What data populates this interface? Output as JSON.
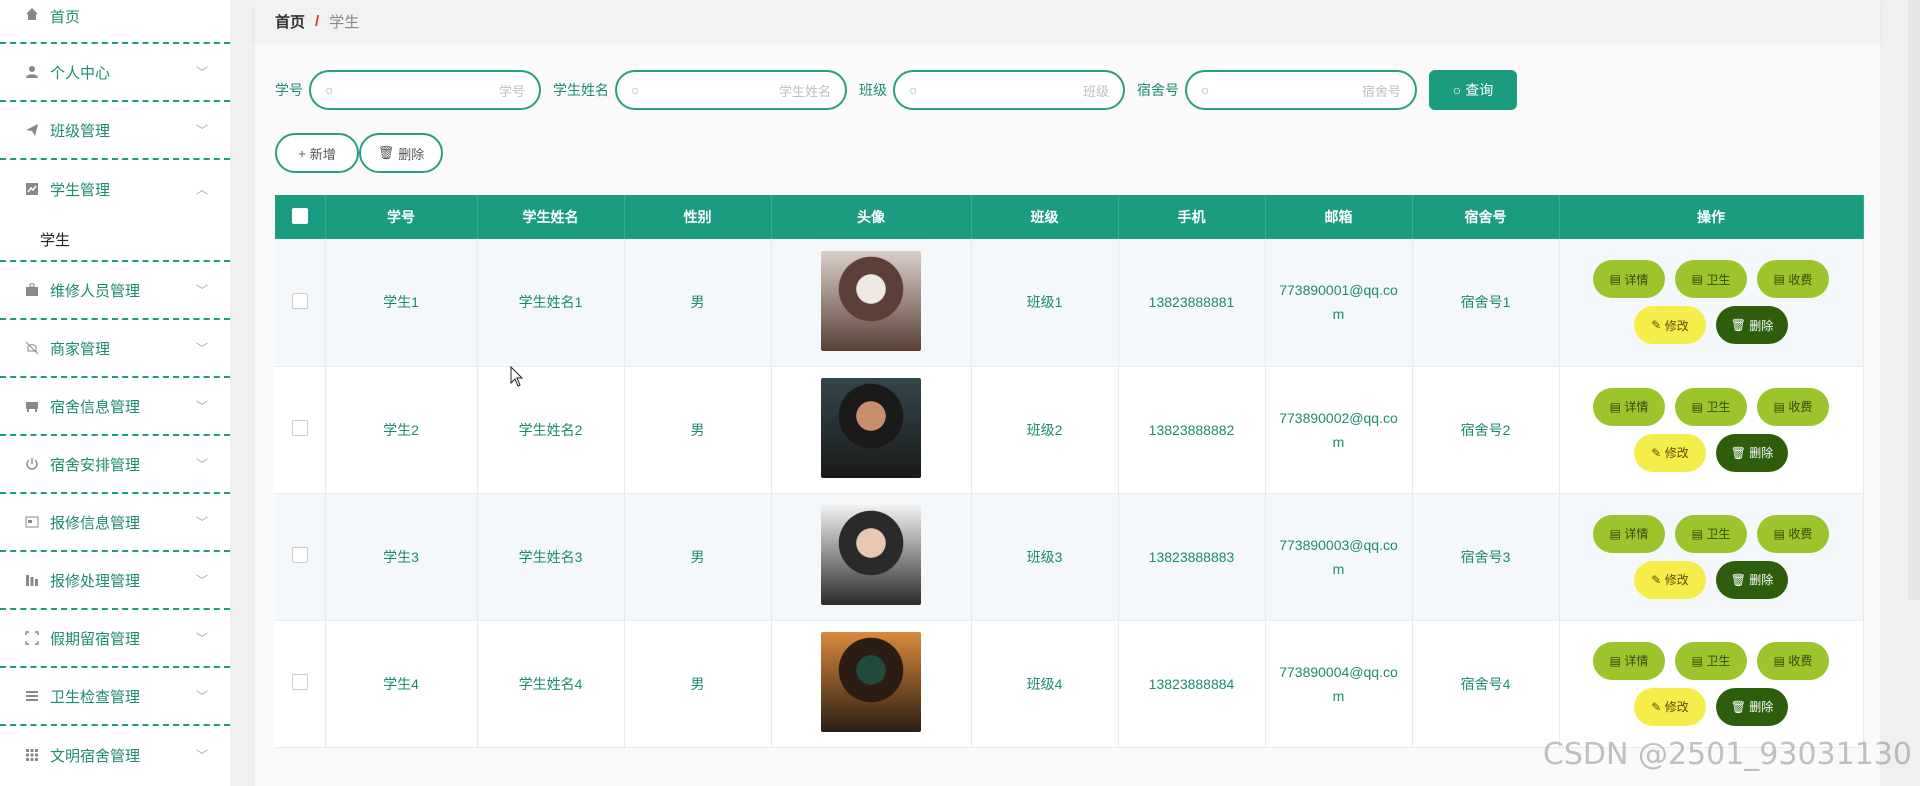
{
  "sidebar": {
    "items": [
      {
        "label": "首页",
        "icon": "home-icon"
      },
      {
        "label": "个人中心",
        "icon": "user-icon"
      },
      {
        "label": "班级管理",
        "icon": "send-icon"
      },
      {
        "label": "学生管理",
        "icon": "chart-icon",
        "expanded": true,
        "sub": "学生"
      },
      {
        "label": "维修人员管理",
        "icon": "briefcase-icon"
      },
      {
        "label": "商家管理",
        "icon": "bell-off-icon"
      },
      {
        "label": "宿舍信息管理",
        "icon": "bed-icon"
      },
      {
        "label": "宿舍安排管理",
        "icon": "power-icon"
      },
      {
        "label": "报修信息管理",
        "icon": "id-card-icon"
      },
      {
        "label": "报修处理管理",
        "icon": "bars-icon"
      },
      {
        "label": "假期留宿管理",
        "icon": "frame-icon"
      },
      {
        "label": "卫生检查管理",
        "icon": "list-icon"
      },
      {
        "label": "文明宿舍管理",
        "icon": "grid-icon"
      }
    ]
  },
  "breadcrumb": {
    "home": "首页",
    "sep": "/",
    "current": "学生"
  },
  "search": {
    "fields": [
      {
        "label": "学号",
        "placeholder": "学号"
      },
      {
        "label": "学生姓名",
        "placeholder": "学生姓名"
      },
      {
        "label": "班级",
        "placeholder": "班级"
      },
      {
        "label": "宿舍号",
        "placeholder": "宿舍号"
      }
    ],
    "query_label": "查询"
  },
  "actions": {
    "add_label": "新增",
    "delete_label": "删除"
  },
  "table": {
    "headers": [
      "学号",
      "学生姓名",
      "性别",
      "头像",
      "班级",
      "手机",
      "邮箱",
      "宿舍号",
      "操作"
    ],
    "rows": [
      {
        "id": "学生1",
        "name": "学生姓名1",
        "gender": "男",
        "cls": "班级1",
        "phone": "13823888881",
        "email": "773890001@qq.com",
        "dorm": "宿舍号1",
        "avatar_colors": [
          "#d9cfc8",
          "#5a4036",
          "#efe9e3"
        ]
      },
      {
        "id": "学生2",
        "name": "学生姓名2",
        "gender": "男",
        "cls": "班级2",
        "phone": "13823888882",
        "email": "773890002@qq.com",
        "dorm": "宿舍号2",
        "avatar_colors": [
          "#33464a",
          "#1a1a1a",
          "#c98f6d"
        ]
      },
      {
        "id": "学生3",
        "name": "学生姓名3",
        "gender": "男",
        "cls": "班级3",
        "phone": "13823888883",
        "email": "773890003@qq.com",
        "dorm": "宿舍号3",
        "avatar_colors": [
          "#f2f2f2",
          "#2a2a2a",
          "#e8c7b4"
        ]
      },
      {
        "id": "学生4",
        "name": "学生姓名4",
        "gender": "男",
        "cls": "班级4",
        "phone": "13823888884",
        "email": "773890004@qq.com",
        "dorm": "宿舍号4",
        "avatar_colors": [
          "#d98a3c",
          "#2b1d14",
          "#1f4a3c"
        ]
      }
    ],
    "op_labels": {
      "detail": "详情",
      "hygiene": "卫生",
      "fee": "收费",
      "edit": "修改",
      "delete": "删除"
    }
  },
  "watermark": "CSDN @2501_93031130"
}
